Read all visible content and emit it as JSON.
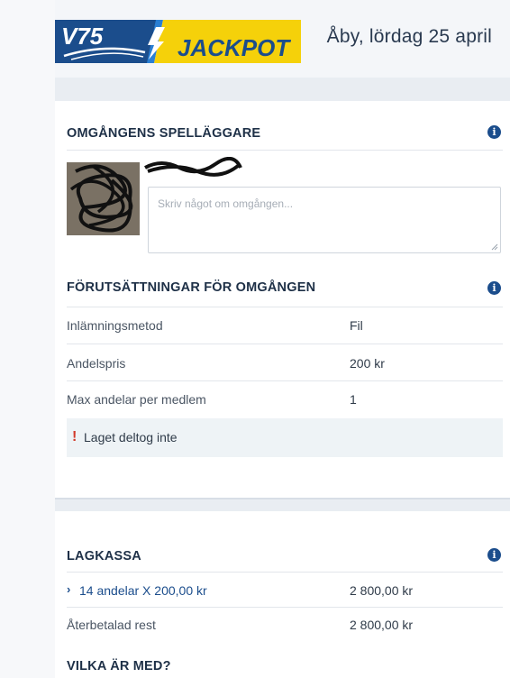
{
  "header": {
    "logo_text_left": "V75",
    "logo_text_right": "JACKPOT",
    "date": "Åby, lördag 25 april"
  },
  "spellaggare": {
    "title": "OMGÅNGENS SPELLÄGGARE",
    "comment_placeholder": "Skriv något om omgången..."
  },
  "forutsattningar": {
    "title": "FÖRUTSÄTTNINGAR FÖR OMGÅNGEN",
    "rows": [
      {
        "label": "Inlämningsmetod",
        "value": "Fil"
      },
      {
        "label": "Andelspris",
        "value": "200 kr"
      },
      {
        "label": "Max andelar per medlem",
        "value": "1"
      }
    ],
    "notice": "Laget deltog inte",
    "notice_mark": "!"
  },
  "lagkassa": {
    "title": "LAGKASSA",
    "shares_link": "14 andelar X 200,00 kr",
    "shares_value": "2 800,00 kr",
    "refund_label": "Återbetalad rest",
    "refund_value": "2 800,00 kr"
  },
  "vilka": {
    "title": "VILKA ÄR MED?"
  },
  "icons": {
    "info": "info-icon",
    "chevron": "chevron-right-icon",
    "alert": "exclamation-icon"
  },
  "colors": {
    "brand_blue": "#1b4d8c",
    "jackpot_yellow": "#f5d10a",
    "alert_red": "#d23a2a"
  }
}
